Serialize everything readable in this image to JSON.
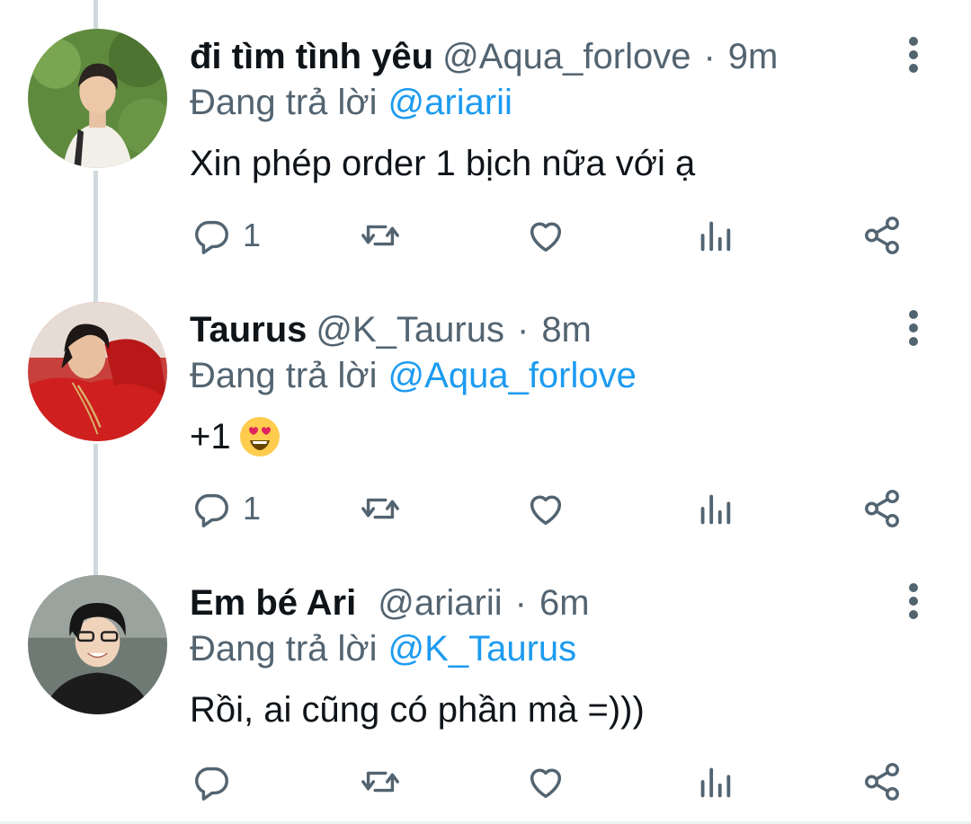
{
  "tweets": [
    {
      "name": "đi tìm tình yêu",
      "handle": "@Aqua_forlove",
      "sep": "·",
      "time": "9m",
      "reply_prefix": "Đang trả lời",
      "reply_to": "@ariarii",
      "text": "Xin phép order 1 bịch nữa với ạ",
      "reply_count": "1"
    },
    {
      "name": "Taurus",
      "handle": "@K_Taurus",
      "sep": "·",
      "time": "8m",
      "reply_prefix": "Đang trả lời",
      "reply_to": "@Aqua_forlove",
      "text": "+1",
      "emoji": "heart-eyes-emoji",
      "reply_count": "1"
    },
    {
      "name": "Em bé Ari",
      "handle": "@ariarii",
      "sep": "·",
      "time": "6m",
      "reply_prefix": "Đang trả lời",
      "reply_to": "@K_Taurus",
      "text": "Rồi, ai cũng có phần mà =)))",
      "reply_count": ""
    }
  ],
  "colors": {
    "text_primary": "#0f1419",
    "text_secondary": "#536471",
    "link": "#1d9bf0",
    "thread_line": "#cfd9de"
  },
  "icons": [
    "reply-icon",
    "retweet-icon",
    "like-icon",
    "analytics-icon",
    "share-icon",
    "more-icon"
  ]
}
